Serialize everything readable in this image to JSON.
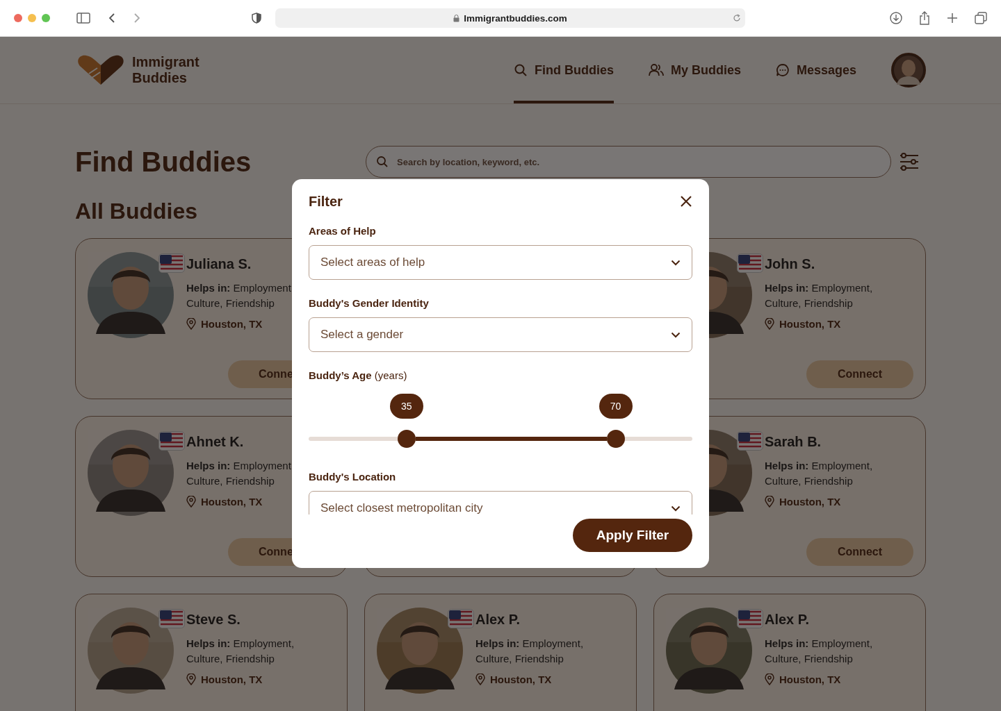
{
  "browser": {
    "url": "Immigrantbuddies.com"
  },
  "site": {
    "logo": [
      "Immigrant",
      "Buddies"
    ],
    "nav": [
      {
        "label": "Find Buddies",
        "selected": true
      },
      {
        "label": "My Buddies",
        "selected": false
      },
      {
        "label": "Messages",
        "selected": false
      }
    ]
  },
  "page": {
    "title": "Find Buddies",
    "search": {
      "placeholder": "Search by location, keyword, etc."
    },
    "section": "All Buddies"
  },
  "buddies": [
    {
      "kind": "partial",
      "name": "Juliana S.",
      "helps": "**Helps in:** Employment, Culture, Friendship",
      "location": "Houston, TX",
      "action": "Conne"
    },
    {
      "kind": "card",
      "name": "John S.",
      "helps": "**Helps in:** Employment, Culture, Friendship",
      "location": "Houston, TX",
      "action": "Connect"
    },
    {
      "kind": "partial",
      "name": "Ahnet K.",
      "helps": "**Helps in:** Employment, Culture, Friendship",
      "location": "Houston, TX",
      "action": "Conne"
    },
    {
      "kind": "covered"
    },
    {
      "kind": "card",
      "name": "Sarah B.",
      "helps": "**Helps in:** Employment, Culture, Friendship",
      "location": "Houston, TX",
      "action": "Connect"
    },
    {
      "kind": "card",
      "name": "Steve S.",
      "helps": "**Helps in:** Employment, Culture, Friendship",
      "location": "Houston, TX"
    },
    {
      "kind": "card",
      "name": "Alex P.",
      "helps": "**Helps in:** Employment, Culture, Friendship",
      "location": "Houston, TX"
    },
    {
      "kind": "card",
      "name": "Alex P.",
      "helps": "**Helps in:** Employment, Culture, Friendship",
      "location": "Houston, TX"
    }
  ],
  "filter": {
    "title": "Filter",
    "fields": [
      {
        "kind": "select",
        "label": "Areas of Help",
        "placeholder": "Select areas of help"
      },
      {
        "kind": "select",
        "label": "Buddy's Gender Identity",
        "placeholder": "Select a gender"
      },
      {
        "kind": "range",
        "label": "**Buddy’s Age** (years)",
        "thumbs": [
          {
            "value": "35",
            "level": 0.255
          },
          {
            "value": "70",
            "level": 0.8
          }
        ]
      },
      {
        "kind": "select",
        "label": "Buddy's Location",
        "placeholder": "Select closest metropolitan city"
      }
    ],
    "apply": "Apply Filter"
  }
}
